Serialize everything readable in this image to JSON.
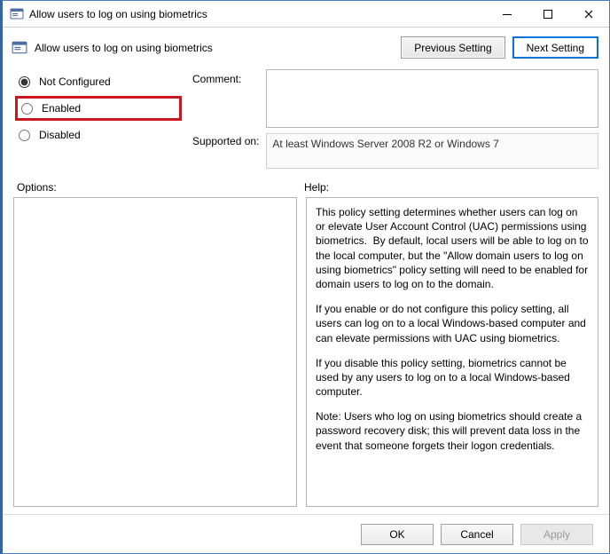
{
  "window": {
    "title": "Allow users to log on using biometrics"
  },
  "header": {
    "policy_title": "Allow users to log on using biometrics",
    "buttons": {
      "previous": "Previous Setting",
      "next": "Next Setting"
    }
  },
  "state": {
    "options": [
      {
        "value": "not_configured",
        "label": "Not Configured",
        "selected": true
      },
      {
        "value": "enabled",
        "label": "Enabled",
        "selected": false,
        "highlighted": true
      },
      {
        "value": "disabled",
        "label": "Disabled",
        "selected": false
      }
    ]
  },
  "labels": {
    "comment": "Comment:",
    "supported_on": "Supported on:",
    "options": "Options:",
    "help": "Help:"
  },
  "fields": {
    "comment_value": "",
    "supported_on_value": "At least Windows Server 2008 R2 or Windows 7"
  },
  "help": {
    "p1": "This policy setting determines whether users can log on or elevate User Account Control (UAC) permissions using biometrics.  By default, local users will be able to log on to the local computer, but the \"Allow domain users to log on using biometrics\" policy setting will need to be enabled for domain users to log on to the domain.",
    "p2": "If you enable or do not configure this policy setting, all users can log on to a local Windows-based computer and can elevate permissions with UAC using biometrics.",
    "p3": "If you disable this policy setting, biometrics cannot be used by any users to log on to a local Windows-based computer.",
    "p4": "Note: Users who log on using biometrics should create a password recovery disk; this will prevent data loss in the event that someone forgets their logon credentials."
  },
  "footer": {
    "ok": "OK",
    "cancel": "Cancel",
    "apply": "Apply"
  }
}
